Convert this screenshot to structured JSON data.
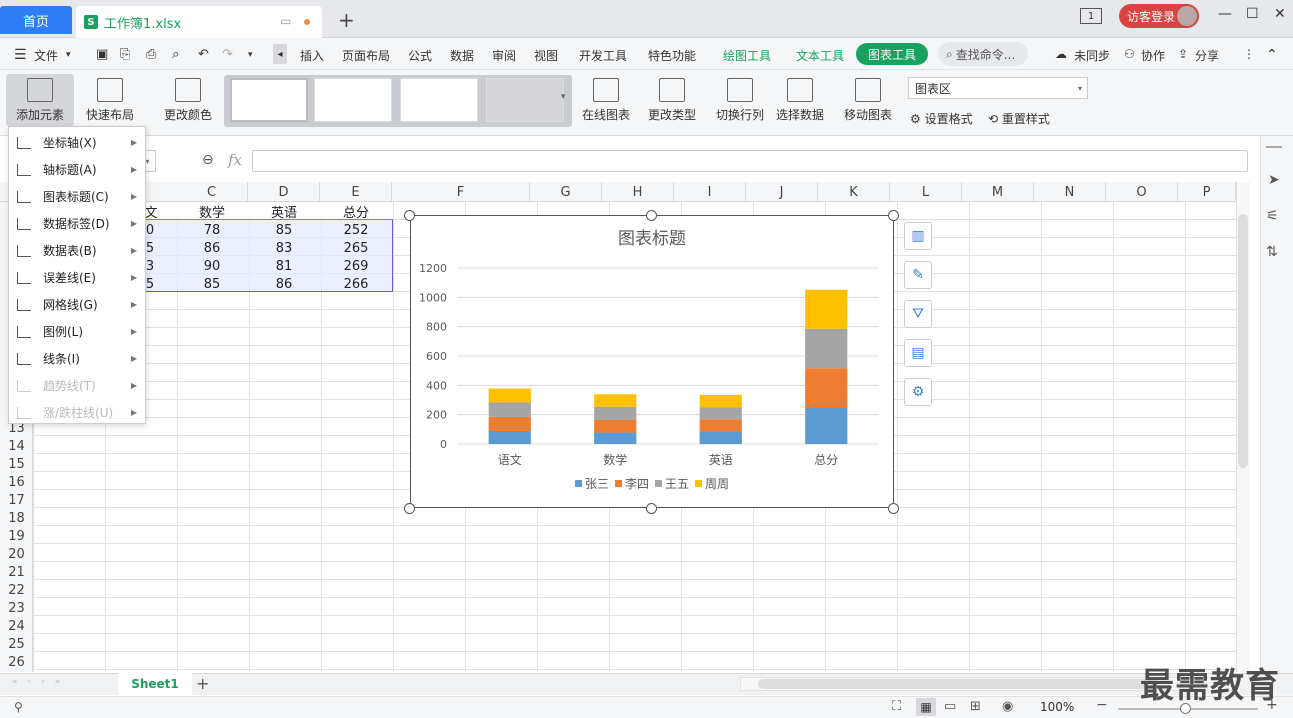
{
  "tabs": {
    "home": "首页",
    "file": "工作簿1.xlsx"
  },
  "title_bar": {
    "page_indicator": "1",
    "login": "访客登录"
  },
  "menubar": {
    "file": "文件",
    "items": [
      "插入",
      "页面布局",
      "公式",
      "数据",
      "审阅",
      "视图",
      "开发工具",
      "特色功能"
    ],
    "context_items": [
      "绘图工具",
      "文本工具"
    ],
    "active_context": "图表工具",
    "search": "查找命令...",
    "sync": "未同步",
    "collab": "协作",
    "share": "分享"
  },
  "ribbon": {
    "add_element": "添加元素",
    "quick_layout": "快速布局",
    "change_color": "更改颜色",
    "online_chart": "在线图表",
    "change_type": "更改类型",
    "switch_row_col": "切换行列",
    "select_data": "选择数据",
    "move_chart": "移动图表",
    "chart_area_select": "图表区",
    "set_format": "设置格式",
    "reset_style": "重置样式"
  },
  "formula_bar": {
    "fx": "fx",
    "value": ""
  },
  "columns": [
    "C",
    "D",
    "E",
    "F",
    "G",
    "H",
    "I",
    "J",
    "K",
    "L",
    "M",
    "N",
    "O",
    "P"
  ],
  "rows": [
    "13",
    "14",
    "15",
    "16",
    "17",
    "18",
    "19",
    "20",
    "21",
    "22",
    "23",
    "24",
    "25",
    "26"
  ],
  "table": {
    "headers": [
      "文",
      "数学",
      "英语",
      "总分"
    ],
    "rows": [
      [
        "0",
        "78",
        "85",
        "252"
      ],
      [
        "5",
        "86",
        "83",
        "265"
      ],
      [
        "3",
        "90",
        "81",
        "269"
      ],
      [
        "5",
        "85",
        "86",
        "266"
      ]
    ]
  },
  "context_menu": {
    "items": [
      {
        "label": "坐标轴(X)",
        "enabled": true
      },
      {
        "label": "轴标题(A)",
        "enabled": true
      },
      {
        "label": "图表标题(C)",
        "enabled": true
      },
      {
        "label": "数据标签(D)",
        "enabled": true
      },
      {
        "label": "数据表(B)",
        "enabled": true
      },
      {
        "label": "误差线(E)",
        "enabled": true
      },
      {
        "label": "网格线(G)",
        "enabled": true
      },
      {
        "label": "图例(L)",
        "enabled": true
      },
      {
        "label": "线条(I)",
        "enabled": true
      },
      {
        "label": "趋势线(T)",
        "enabled": false
      },
      {
        "label": "涨/跌柱线(U)",
        "enabled": false
      }
    ]
  },
  "chart_data": {
    "type": "bar",
    "stacked": true,
    "title": "图表标题",
    "categories": [
      "语文",
      "数学",
      "英语",
      "总分"
    ],
    "series": [
      {
        "name": "张三",
        "color": "#5b9bd5",
        "values": [
          89,
          78,
          85,
          252
        ]
      },
      {
        "name": "李四",
        "color": "#ed7d31",
        "values": [
          96,
          86,
          83,
          265
        ]
      },
      {
        "name": "王五",
        "color": "#a5a5a5",
        "values": [
          98,
          90,
          81,
          269
        ]
      },
      {
        "name": "周周",
        "color": "#ffc000",
        "values": [
          95,
          85,
          86,
          266
        ]
      }
    ],
    "yticks": [
      "0",
      "200",
      "400",
      "600",
      "800",
      "1000",
      "1200"
    ],
    "ylim": [
      0,
      1200
    ],
    "grid": true,
    "legend_position": "bottom"
  },
  "sheets": {
    "active": "Sheet1"
  },
  "status": {
    "zoom": "100%"
  },
  "watermark": "最需教育"
}
